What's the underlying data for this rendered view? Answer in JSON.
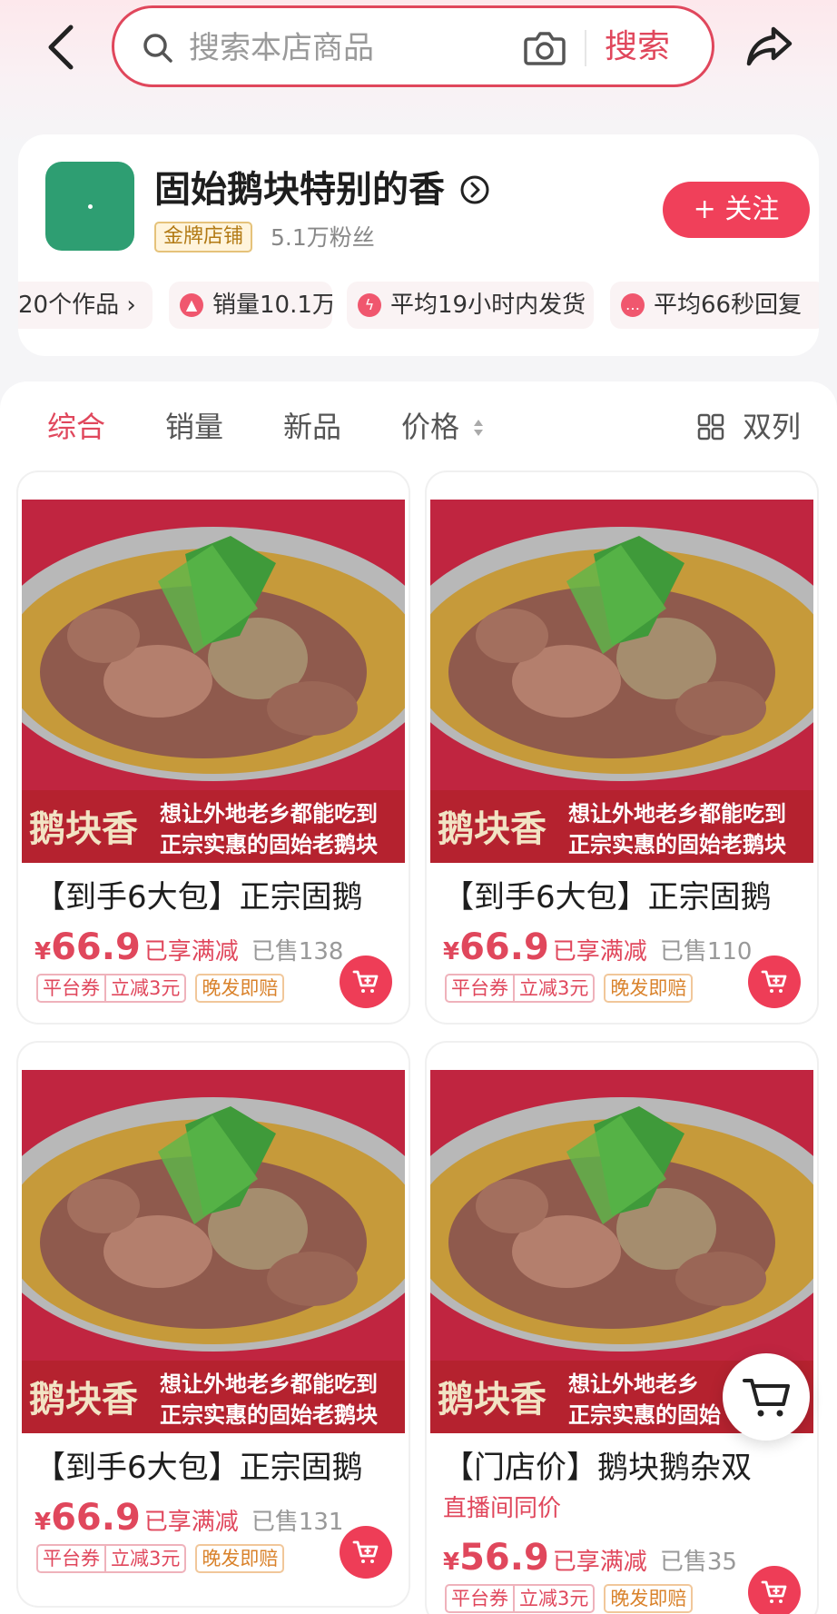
{
  "search": {
    "placeholder": "搜索本店商品",
    "button_label": "搜索"
  },
  "shop": {
    "name": "固始鹅块特别的香",
    "badge": "金牌店铺",
    "fans": "5.1万粉丝",
    "follow_label": "+ 关注",
    "stats": [
      {
        "label": "20个作品 ›",
        "icon": "works-icon"
      },
      {
        "label": "销量10.1万",
        "icon": "sales-icon"
      },
      {
        "label": "平均19小时内发货",
        "icon": "lightning-icon"
      },
      {
        "label": "平均66秒回复",
        "icon": "chat-icon"
      }
    ]
  },
  "sort_tabs": [
    {
      "label": "综合",
      "active": true
    },
    {
      "label": "销量",
      "active": false
    },
    {
      "label": "新品",
      "active": false
    },
    {
      "label": "价格",
      "active": false
    }
  ],
  "layout_toggle": "双列",
  "products": [
    {
      "title": "【到手6大包】正宗固鹅",
      "price_symbol": "¥",
      "price": "66.9",
      "discount": "已享满减",
      "sold": "已售138",
      "coupon_a": "平台券",
      "coupon_b": "立减3元",
      "guarantee": "晚发即赔",
      "banner_brand": "鹅块香",
      "banner_line1": "想让外地老乡都能吃到",
      "banner_line2": "正宗实惠的固始老鹅块"
    },
    {
      "title": "【到手6大包】正宗固鹅",
      "price_symbol": "¥",
      "price": "66.9",
      "discount": "已享满减",
      "sold": "已售110",
      "coupon_a": "平台券",
      "coupon_b": "立减3元",
      "guarantee": "晚发即赔",
      "banner_brand": "鹅块香",
      "banner_line1": "想让外地老乡都能吃到",
      "banner_line2": "正宗实惠的固始老鹅块"
    },
    {
      "title": "【到手6大包】正宗固鹅",
      "price_symbol": "¥",
      "price": "66.9",
      "discount": "已享满减",
      "sold": "已售131",
      "coupon_a": "平台券",
      "coupon_b": "立减3元",
      "guarantee": "晚发即赔",
      "banner_brand": "鹅块香",
      "banner_line1": "想让外地老乡都能吃到",
      "banner_line2": "正宗实惠的固始老鹅块"
    },
    {
      "title": "【门店价】鹅块鹅杂双",
      "live_tag": "直播间同价",
      "price_symbol": "¥",
      "price": "56.9",
      "discount": "已享满减",
      "sold": "已售35",
      "coupon_a": "平台券",
      "coupon_b": "立减3元",
      "guarantee": "晚发即赔",
      "banner_brand": "鹅块香",
      "banner_line1": "想让外地老乡",
      "banner_line2": "正宗实惠的固始"
    }
  ],
  "colors": {
    "accent": "#e0475c",
    "follow": "#f0405a",
    "avatar": "#2e9e72",
    "gold_badge_text": "#b27a14"
  }
}
